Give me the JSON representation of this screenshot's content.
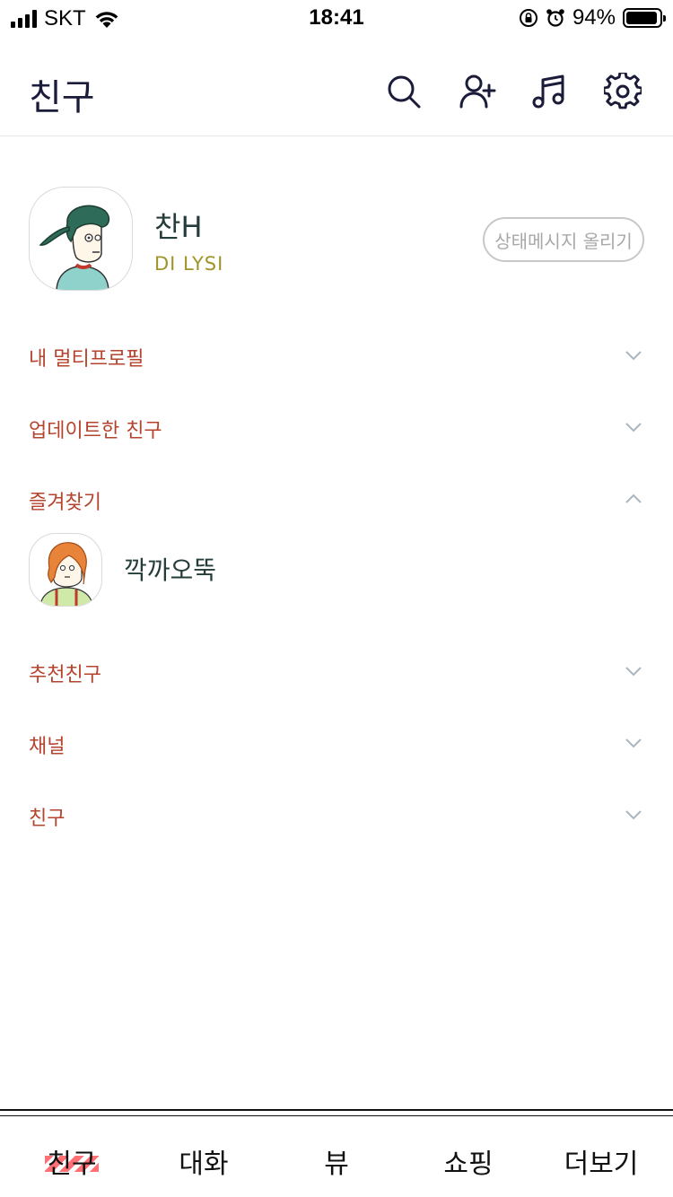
{
  "status_bar": {
    "carrier": "SKT",
    "time": "18:41",
    "battery": "94%",
    "battery_level": 0.94
  },
  "header": {
    "title": "친구",
    "icons": [
      "search-icon",
      "add-friend-icon",
      "music-icon",
      "settings-icon"
    ]
  },
  "profile": {
    "name": "찬H",
    "status_message": "DI LYSI",
    "status_button": "상태메시지 올리기"
  },
  "sections": [
    {
      "label": "내 멀티프로필",
      "expanded": false
    },
    {
      "label": "업데이트한 친구",
      "expanded": false
    },
    {
      "label": "즐겨찾기",
      "expanded": true
    },
    {
      "label": "추천친구",
      "expanded": false
    },
    {
      "label": "채널",
      "expanded": false
    },
    {
      "label": "친구",
      "expanded": false
    }
  ],
  "favorites": [
    {
      "name": "깍까오뚝"
    }
  ],
  "tabs": [
    {
      "label": "친구",
      "active": true
    },
    {
      "label": "대화",
      "active": false
    },
    {
      "label": "뷰",
      "active": false
    },
    {
      "label": "쇼핑",
      "active": false
    },
    {
      "label": "더보기",
      "active": false
    }
  ],
  "colors": {
    "section_label": "#b5432d",
    "status_message": "#a09428",
    "name": "#243c3a",
    "active_tab_highlight": "#ff6f76"
  }
}
